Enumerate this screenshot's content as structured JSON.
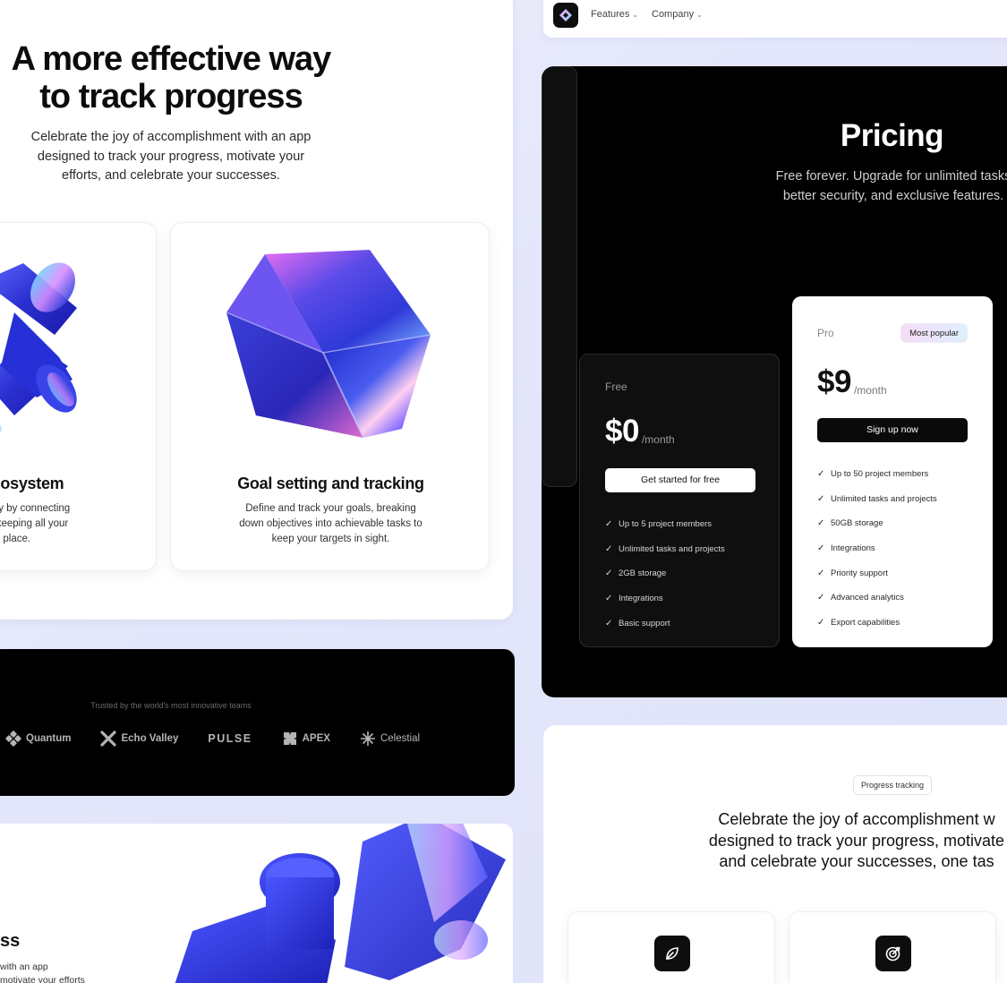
{
  "hero": {
    "title_line1": "A more effective way",
    "title_line2": "to track progress",
    "subtitle_line1": "Celebrate the joy of accomplishment with an app",
    "subtitle_line2": "designed to track your progress, motivate your",
    "subtitle_line3": "efforts, and celebrate your successes."
  },
  "feature_cards": [
    {
      "title": "ecosystem",
      "text_line1": "tivity by connecting",
      "text_line2": "ls, keeping all your",
      "text_line3": "one place."
    },
    {
      "title": "Goal setting and tracking",
      "text_line1": "Define and track your goals, breaking",
      "text_line2": "down objectives into achievable tasks to",
      "text_line3": "keep your targets in sight."
    }
  ],
  "logos": {
    "caption": "Trusted by the world's most innovative teams",
    "items": [
      {
        "name": "Quantum",
        "icon": "quantum-logo-icon"
      },
      {
        "name": "Echo Valley",
        "icon": "echo-valley-logo-icon"
      },
      {
        "name": "PULSE",
        "icon": "pulse-logo-icon"
      },
      {
        "name": "APEX",
        "icon": "apex-logo-icon"
      },
      {
        "name": "Celestial",
        "icon": "celestial-logo-icon"
      }
    ]
  },
  "bottom_left": {
    "title": "ss",
    "text_line1": "with an app",
    "text_line2": "motivate your efforts"
  },
  "nav": {
    "logo": "app-logo-icon",
    "items": [
      {
        "label": "Features"
      },
      {
        "label": "Company"
      }
    ]
  },
  "pricing": {
    "title": "Pricing",
    "subtitle_line1": "Free forever. Upgrade for unlimited tasks",
    "subtitle_line2": "better security, and exclusive features.",
    "plans": [
      {
        "name": "Free",
        "price": "$0",
        "period": "/month",
        "cta": "Get started for free",
        "features": [
          "Up to 5 project members",
          "Unlimited tasks and projects",
          "2GB storage",
          "Integrations",
          "Basic support"
        ]
      },
      {
        "name": "Pro",
        "badge": "Most popular",
        "price": "$9",
        "period": "/month",
        "cta": "Sign up now",
        "features": [
          "Up to 50 project members",
          "Unlimited tasks and projects",
          "50GB storage",
          "Integrations",
          "Priority support",
          "Advanced analytics",
          "Export capabilities"
        ]
      }
    ]
  },
  "progress": {
    "pill": "Progress tracking",
    "heading_line1": "Celebrate the joy of accomplishment w",
    "heading_line2": "designed to track your progress, motivate",
    "heading_line3": "and celebrate your successes, one tas",
    "cards": [
      {
        "icon": "leaf-icon"
      },
      {
        "icon": "target-icon"
      }
    ]
  },
  "colors": {
    "background": "#e4e7fb",
    "dark_panel": "#000000",
    "accent_blue": "#2f3bd8",
    "badge_gradient_start": "#f7dcf5",
    "badge_gradient_end": "#dff0fb"
  }
}
